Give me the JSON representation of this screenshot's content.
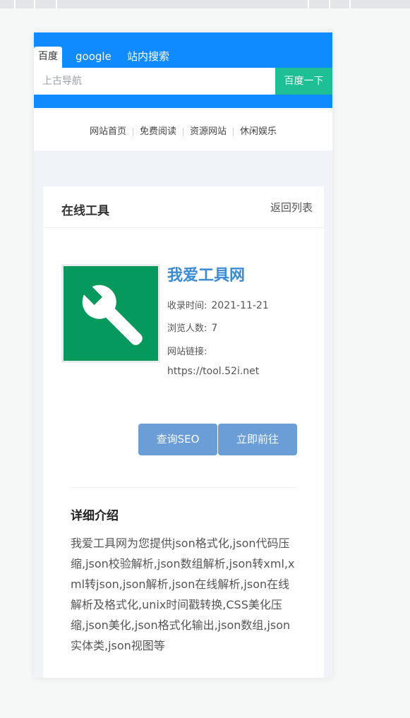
{
  "search": {
    "tabs": [
      {
        "label": "百度"
      },
      {
        "label": "google"
      },
      {
        "label": "站内搜索"
      }
    ],
    "placeholder": "上古导航",
    "button_label": "百度一下"
  },
  "nav": {
    "links": [
      {
        "label": "网站首页"
      },
      {
        "label": "免费阅读"
      },
      {
        "label": "资源网站"
      },
      {
        "label": "休闲娱乐"
      }
    ]
  },
  "card": {
    "title": "在线工具",
    "back_label": "返回列表",
    "site": {
      "logo_icon": "wrench-icon",
      "name": "我爱工具网",
      "recorded_label": "收录时间:",
      "recorded_value": "2021-11-21",
      "views_label": "浏览人数:",
      "views_value": "7",
      "link_label": "网站链接:",
      "url": "https://tool.52i.net"
    },
    "buttons": {
      "seo_label": "查询SEO",
      "visit_label": "立即前往"
    },
    "detail": {
      "title": "详细介绍",
      "text": "我爱工具网为您提供json格式化,json代码压缩,json校验解析,json数组解析,json转xml,xml转json,json解析,json在线解析,json在线解析及格式化,unix时间戳转换,CSS美化压缩,json美化,json格式化输出,json数组,json实体类,json视图等"
    }
  },
  "colors": {
    "header_blue": "#0f8bff",
    "search_button": "#1fbf96",
    "site_name": "#3b8ad6",
    "action_button": "#6b9ed6",
    "logo_bg": "#05995e"
  }
}
